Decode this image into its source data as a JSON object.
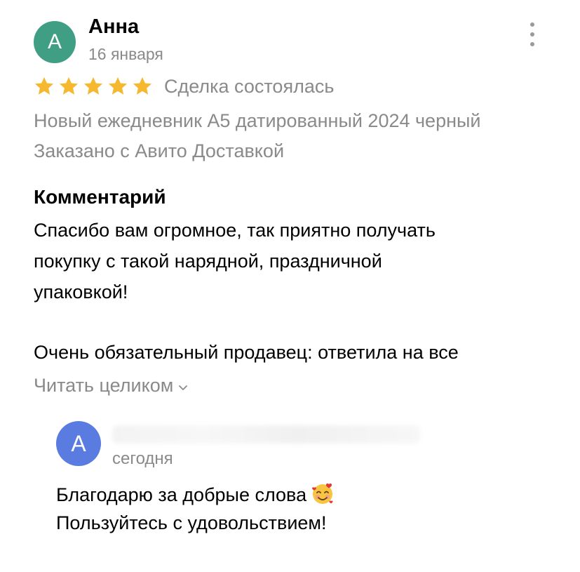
{
  "review": {
    "avatar_letter": "А",
    "author_name": "Анна",
    "date": "16 января",
    "rating": 5,
    "rating_max": 5,
    "deal_status": "Сделка состоялась",
    "product_title": "Новый ежедневник А5 датированный 2024 черный",
    "delivery_note": "Заказано с Авито Доставкой",
    "comment_heading": "Комментарий",
    "comment_lines": [
      "Спасибо вам огромное, так приятно получать",
      "покупку с такой нарядной, праздничной",
      "упаковкой!",
      "Очень обязательный продавец: ответила на все"
    ],
    "read_more_label": "Читать целиком"
  },
  "reply": {
    "avatar_letter": "А",
    "date": "сегодня",
    "lines": [
      "Благодарю за добрые слова",
      "Пользуйтесь с удовольствием!"
    ]
  },
  "colors": {
    "avatar_main": "#3f9e84",
    "avatar_reply": "#5a7be0",
    "star": "#f5b82e",
    "secondary_text": "#8a8a8a"
  },
  "icons": {
    "more": "more-vertical-icon",
    "star": "star-icon",
    "chevron": "chevron-down-icon",
    "emoji": "smiling-face-with-hearts-icon"
  }
}
